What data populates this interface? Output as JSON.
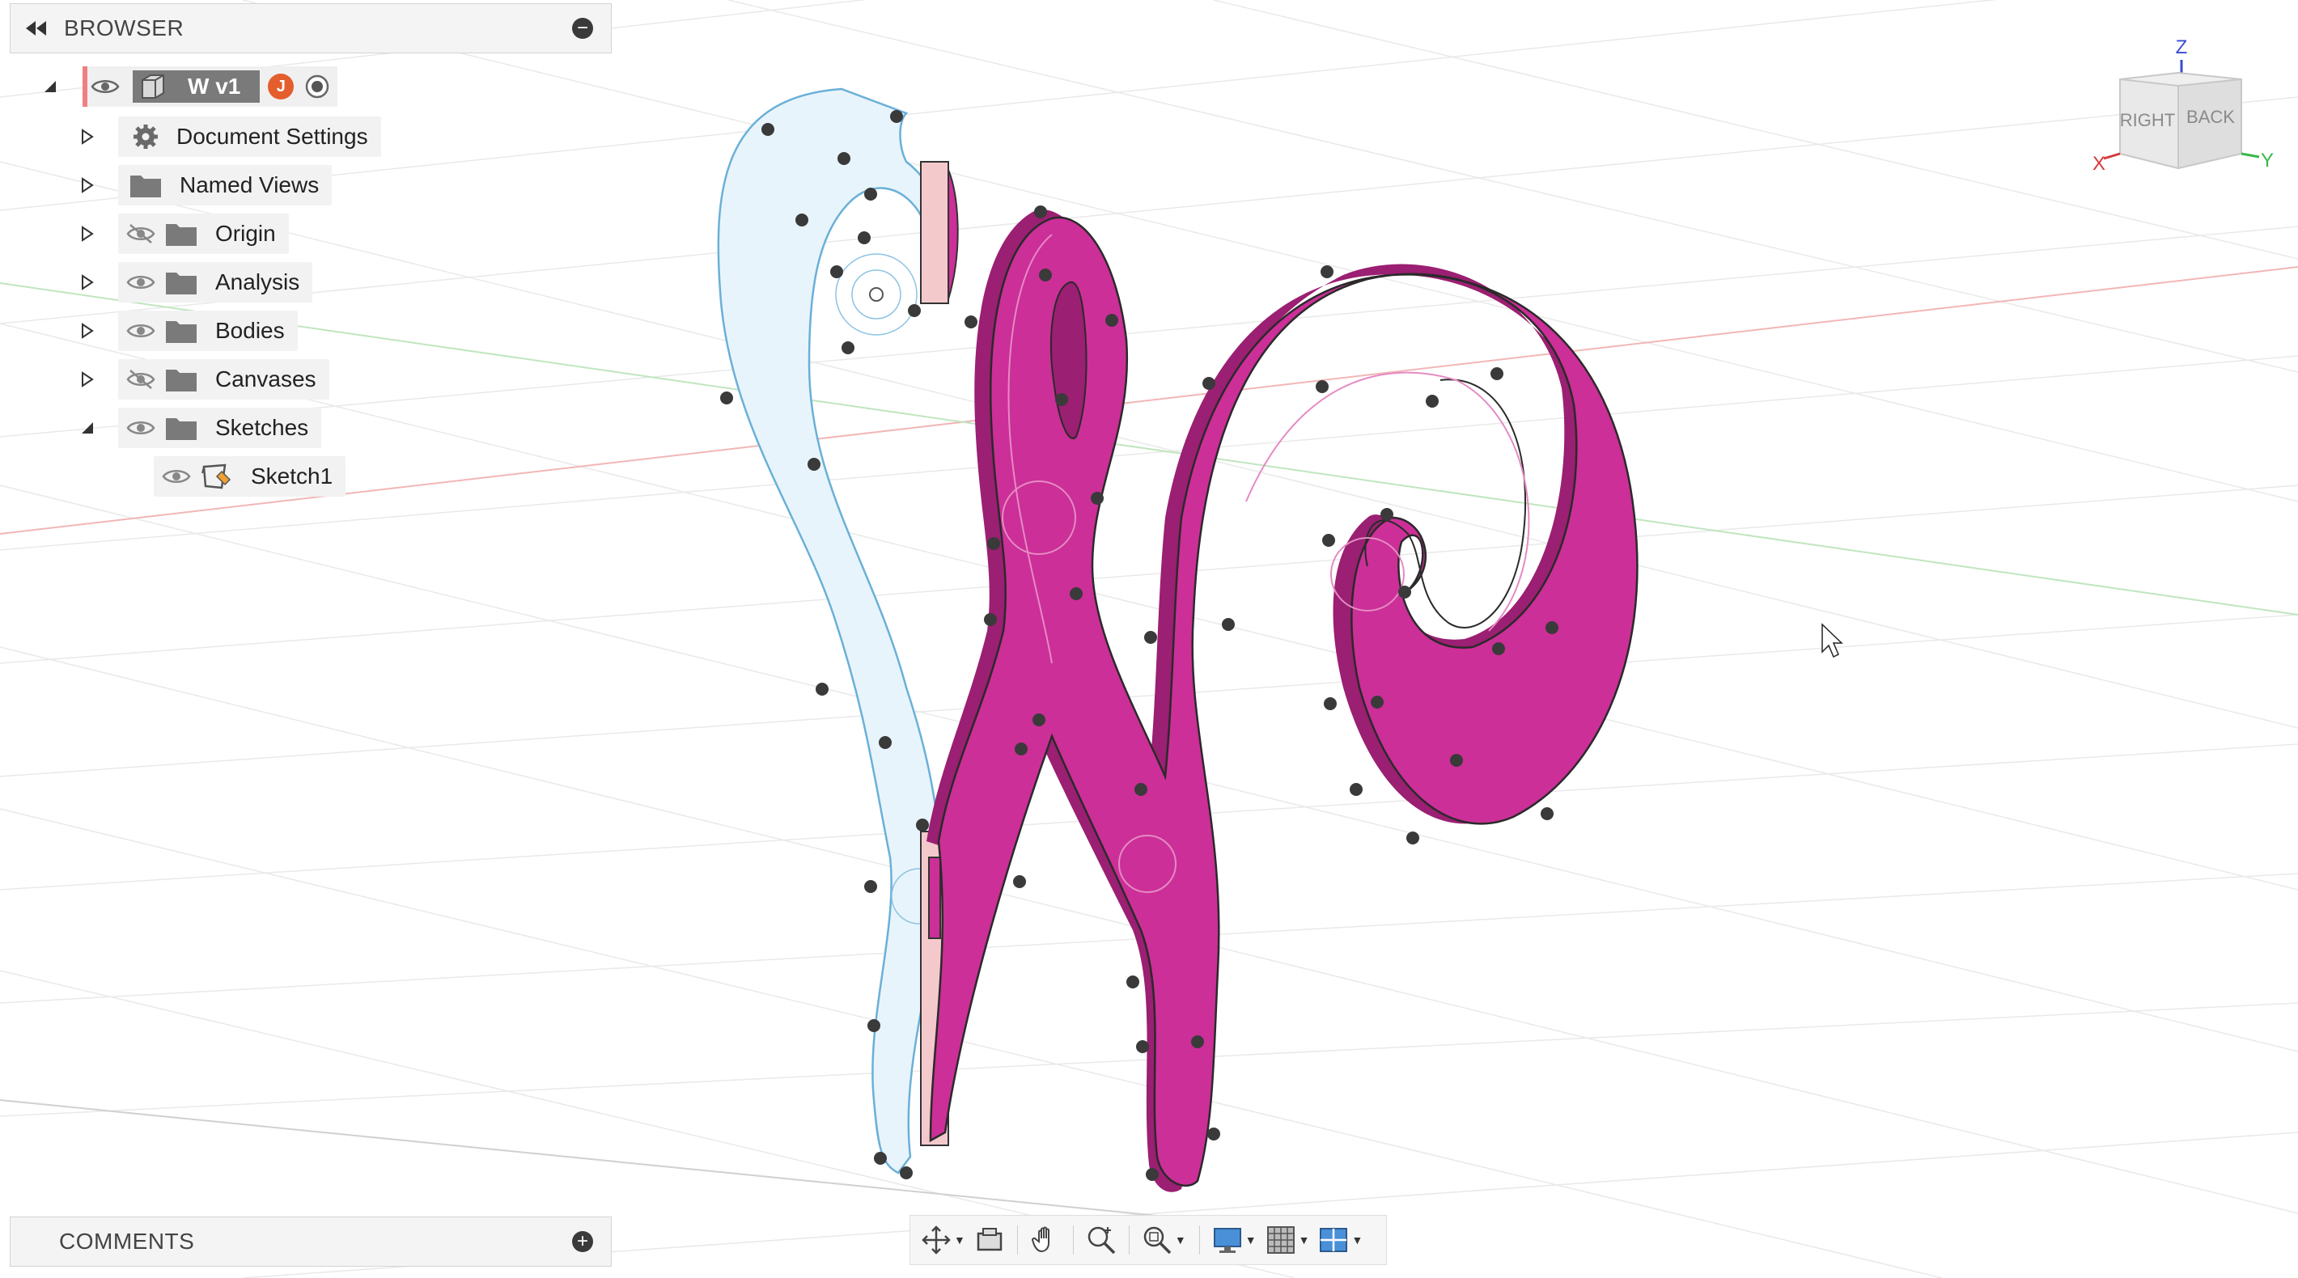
{
  "browser": {
    "title": "BROWSER",
    "root_name": "W v1",
    "root_badge": "J",
    "items": [
      {
        "label": "Document Settings",
        "icon": "gear-icon",
        "visibility": "none"
      },
      {
        "label": "Named Views",
        "icon": "folder-icon",
        "visibility": "none"
      },
      {
        "label": "Origin",
        "icon": "folder-icon",
        "visibility": "hidden"
      },
      {
        "label": "Analysis",
        "icon": "folder-icon",
        "visibility": "visible"
      },
      {
        "label": "Bodies",
        "icon": "folder-icon",
        "visibility": "visible"
      },
      {
        "label": "Canvases",
        "icon": "folder-icon",
        "visibility": "hidden"
      },
      {
        "label": "Sketches",
        "icon": "folder-icon",
        "visibility": "visible",
        "expanded": true
      }
    ],
    "sketch_child": {
      "label": "Sketch1",
      "icon": "sketch-icon"
    }
  },
  "comments": {
    "title": "COMMENTS"
  },
  "viewcube": {
    "top": "Z",
    "right_face": "RIGHT",
    "back_face": "BACK",
    "x_axis": "X",
    "y_axis": "Y"
  },
  "nav_toolbar": {
    "icons": [
      "orbit-icon",
      "look-at-icon",
      "pan-icon",
      "zoom-icon",
      "fit-icon",
      "display-settings-icon",
      "grid-icon",
      "viewports-icon"
    ]
  },
  "colors": {
    "body_magenta": "#cc2f98",
    "body_shadow": "#9b1f72",
    "sketch_fill": "#e8f4fb",
    "sketch_line": "#6ab0d8",
    "root_accent": "#f07f83",
    "badge": "#e45d2c"
  }
}
